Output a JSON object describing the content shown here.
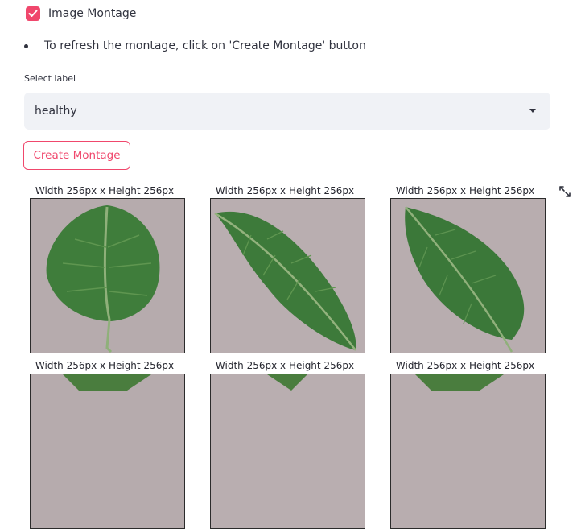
{
  "checkbox": {
    "label": "Image Montage",
    "checked": true
  },
  "bullet": {
    "text": "To refresh the montage, click on 'Create Montage' button"
  },
  "select": {
    "label": "Select label",
    "value": "healthy"
  },
  "button": {
    "label": "Create Montage"
  },
  "montage": {
    "captions": [
      "Width 256px x Height 256px",
      "Width 256px x Height 256px",
      "Width 256px x Height 256px",
      "Width 256px x Height 256px",
      "Width 256px x Height 256px",
      "Width 256px x Height 256px"
    ],
    "images": [
      "leaf-image",
      "leaf-image",
      "leaf-image"
    ]
  },
  "icons": {
    "expand": "expand-icon",
    "check": "check-icon",
    "caret": "caret-down-icon"
  },
  "colors": {
    "accent": "#f0476c",
    "select_bg": "#f0f2f6",
    "leaf": "#3d7a3a",
    "background_photo": "#b3a7a9"
  }
}
